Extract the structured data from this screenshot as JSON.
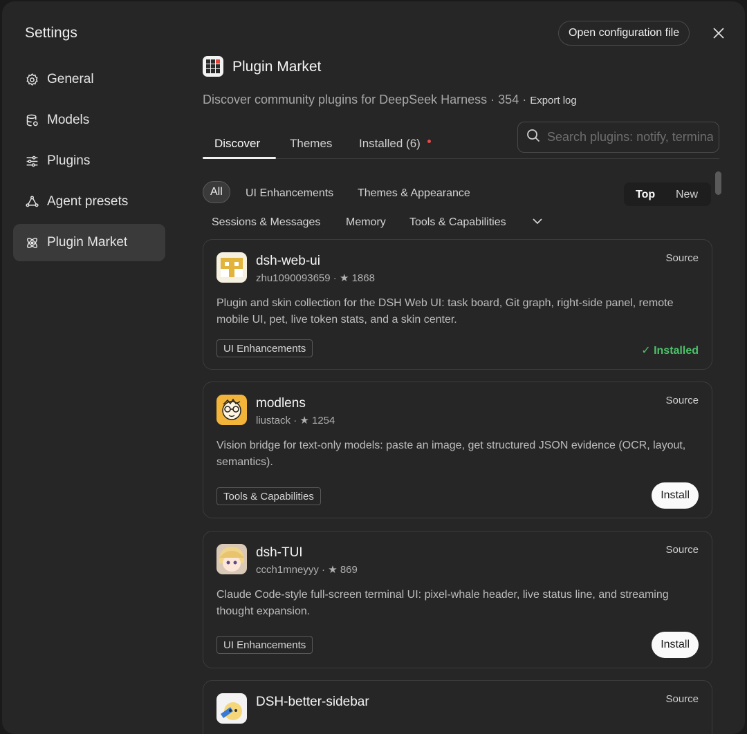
{
  "sidebar": {
    "title": "Settings",
    "items": [
      {
        "label": "General",
        "icon": "gear-icon"
      },
      {
        "label": "Models",
        "icon": "database-icon"
      },
      {
        "label": "Plugins",
        "icon": "sliders-icon"
      },
      {
        "label": "Agent presets",
        "icon": "agent-icon"
      },
      {
        "label": "Plugin Market",
        "icon": "atom-icon",
        "active": true
      }
    ]
  },
  "toolbar": {
    "open_config_label": "Open configuration file",
    "close_icon": "close-icon"
  },
  "header": {
    "title": "Plugin Market",
    "subtitle": "Discover community plugins for DeepSeek Harness · 354 · ",
    "export_label": "Export log"
  },
  "tabs": [
    {
      "label": "Discover",
      "active": true
    },
    {
      "label": "Themes"
    },
    {
      "label": "Installed (6)"
    }
  ],
  "search": {
    "placeholder": "Search plugins: notify, terminal"
  },
  "filters": {
    "all": "All",
    "categories": [
      "UI Enhancements",
      "Themes & Appearance",
      "Sessions & Messages",
      "Memory",
      "Tools & Capabilities"
    ]
  },
  "sort": {
    "options": [
      "Top",
      "New"
    ],
    "selected": "Top"
  },
  "colors": {
    "accent_installed": "#4cc36a",
    "badge_dot": "#ea4a4a"
  },
  "plugins": [
    {
      "name": "dsh-web-ui",
      "author": "zhu1090093659",
      "stars": "1868",
      "source_label": "Source",
      "description": "Plugin and skin collection for the DSH Web UI: task board, Git graph, right-side panel, remote mobile UI, pet, live token stats, and a skin center.",
      "tag": "UI Enhancements",
      "status": "✓ Installed"
    },
    {
      "name": "modlens",
      "author": "liustack",
      "stars": "1254",
      "source_label": "Source",
      "description": "Vision bridge for text-only models: paste an image, get structured JSON evidence (OCR, layout, semantics).",
      "tag": "Tools & Capabilities",
      "action": "Install"
    },
    {
      "name": "dsh-TUI",
      "author": "ccch1mneyyy",
      "stars": "869",
      "source_label": "Source",
      "description": "Claude Code-style full-screen terminal UI: pixel-whale header, live status line, and streaming thought expansion.",
      "tag": "UI Enhancements",
      "action": "Install"
    },
    {
      "name": "DSH-better-sidebar",
      "source_label": "Source"
    }
  ],
  "meta_separator": " · ",
  "star_glyph": "★"
}
